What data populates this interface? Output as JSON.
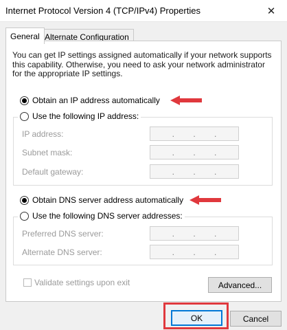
{
  "window": {
    "title": "Internet Protocol Version 4 (TCP/IPv4) Properties",
    "close_glyph": "✕"
  },
  "tabs": [
    {
      "label": "General",
      "active": true
    },
    {
      "label": "Alternate Configuration",
      "active": false
    }
  ],
  "intro_text": "You can get IP settings assigned automatically if your network supports this capability. Otherwise, you need to ask your network administrator for the appropriate IP settings.",
  "ip_section": {
    "auto_label": "Obtain an IP address automatically",
    "auto_selected": true,
    "manual_label": "Use the following IP address:",
    "manual_selected": false,
    "fields": [
      {
        "label": "IP address:",
        "value": " .   .   . "
      },
      {
        "label": "Subnet mask:",
        "value": " .   .   . "
      },
      {
        "label": "Default gateway:",
        "value": " .   .   . "
      }
    ]
  },
  "dns_section": {
    "auto_label": "Obtain DNS server address automatically",
    "auto_selected": true,
    "manual_label": "Use the following DNS server addresses:",
    "manual_selected": false,
    "fields": [
      {
        "label": "Preferred DNS server:",
        "value": " .   .   . "
      },
      {
        "label": "Alternate DNS server:",
        "value": " .   .   . "
      }
    ]
  },
  "validate_label": "Validate settings upon exit",
  "validate_checked": false,
  "buttons": {
    "advanced": "Advanced...",
    "ok": "OK",
    "cancel": "Cancel"
  },
  "colors": {
    "annotation_red": "#e0383d",
    "focus_blue": "#0078d7"
  }
}
